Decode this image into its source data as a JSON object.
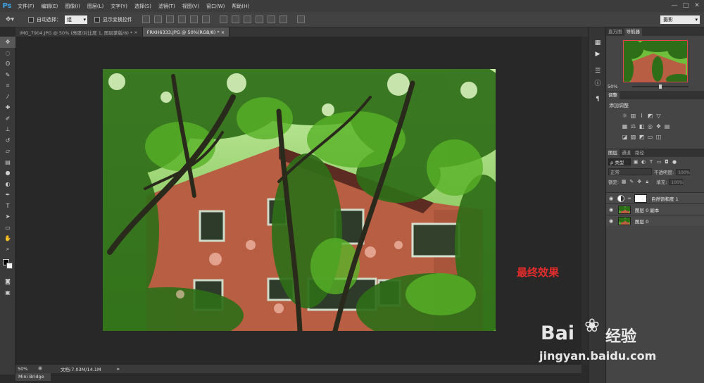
{
  "app": {
    "logo": "Ps",
    "menu": [
      "文件(F)",
      "编辑(E)",
      "图像(I)",
      "图层(L)",
      "文字(Y)",
      "选择(S)",
      "滤镜(T)",
      "视图(V)",
      "窗口(W)",
      "帮助(H)"
    ],
    "window_controls": [
      "—",
      "□",
      "✕"
    ]
  },
  "options_bar": {
    "auto_select_label": "自动选择：",
    "auto_select_value": "组",
    "show_transform_label": "显示变换控件",
    "workspace": "摄影"
  },
  "tabs": [
    {
      "label": "IMG_7904.JPG @ 50% (亮度/对比度 1, 图层蒙版/8) *",
      "close": "×",
      "active": false
    },
    {
      "label": "FRXH6333.JPG @ 50%(RGB/8) *",
      "close": "×",
      "active": true
    }
  ],
  "canvas": {
    "annotation": "最终效果"
  },
  "status_bar": {
    "zoom": "50%",
    "doc_info": "文档:7.03M/14.1M",
    "arrow": "▸"
  },
  "mini_bridge": "Mini Bridge",
  "navigator_panel": {
    "tabs": [
      "直方图",
      "导航器"
    ],
    "zoom": "50%"
  },
  "adjustments_panel": {
    "tab": "调整",
    "title": "添加调整"
  },
  "layers_panel": {
    "tabs": [
      "图层",
      "通道",
      "路径"
    ],
    "kind": "ρ 类型",
    "blend_mode": "正常",
    "opacity_label": "不透明度:",
    "opacity_value": "100%",
    "lock_label": "锁定:",
    "fill_label": "填充:",
    "fill_value": "100%",
    "layers": [
      {
        "name": "自然饱和度 1",
        "type": "adjustment"
      },
      {
        "name": "图层 0 副本",
        "type": "pixel"
      },
      {
        "name": "图层 0",
        "type": "pixel"
      }
    ]
  },
  "watermark": {
    "brand": "Bai",
    "brand_suffix": "经验",
    "url": "jingyan.baidu.com"
  },
  "colors": {
    "accent_red": "#e32c2c",
    "ps_blue": "#3ea3e6",
    "panel_bg": "#454545",
    "canvas_bg": "#282828"
  }
}
